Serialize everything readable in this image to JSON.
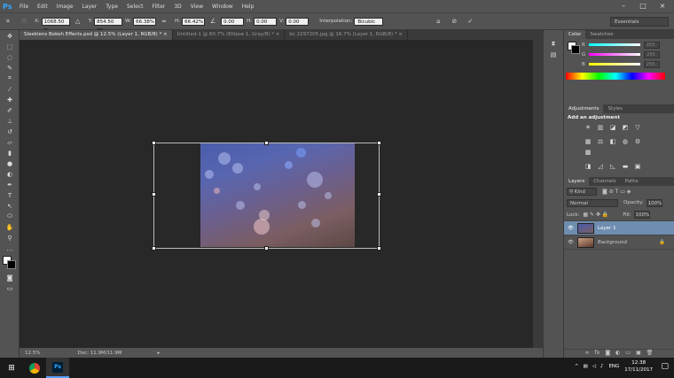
{
  "app": {
    "logo": "Ps"
  },
  "menu": [
    "File",
    "Edit",
    "Image",
    "Layer",
    "Type",
    "Select",
    "Filter",
    "3D",
    "View",
    "Window",
    "Help"
  ],
  "window_controls": [
    "–",
    "□",
    "×"
  ],
  "options": {
    "x_label": "X:",
    "x_value": "1068.50 p",
    "y_label": "Y:",
    "y_value": "854.50 px",
    "w_label": "W:",
    "w_value": "66.38%",
    "h_label": "H:",
    "h_value": "66.42%",
    "angle_value": "0.00",
    "hskew_label": "H:",
    "hskew_value": "0.00",
    "vskew_label": "V:",
    "vskew_value": "0.00",
    "interp_label": "Interpolation:",
    "interp_value": "Bicubic",
    "workspace": "Essentials"
  },
  "tabs": [
    "Sleeklens Bokeh Effects.psd @ 12.5% (Layer 1, RGB/8) * ×",
    "Untitled-1 @ 60.7% (Ellipse 1, Gray/8) * ×",
    "bc 2297205.jpg @ 16.7% (Layer 1, RGB/8) * ×"
  ],
  "status": {
    "zoom": "12.5%",
    "doc": "Doc: 11.9M/11.9M"
  },
  "color_panel": {
    "tabs": [
      "Color",
      "Swatches"
    ],
    "r_label": "R",
    "r_value": "255",
    "g_label": "G",
    "g_value": "255",
    "b_label": "B",
    "b_value": "255"
  },
  "adjustments_panel": {
    "tabs": [
      "Adjustments",
      "Styles"
    ],
    "heading": "Add an adjustment"
  },
  "layers_panel": {
    "tabs": [
      "Layers",
      "Channels",
      "Paths"
    ],
    "kind_label": "Kind",
    "blend_mode": "Normal",
    "opacity_label": "Opacity:",
    "opacity_value": "100%",
    "lock_label": "Lock:",
    "fill_label": "Fill:",
    "fill_value": "100%",
    "layers": [
      "Layer 1",
      "Background"
    ]
  },
  "taskbar": {
    "lang": "ENG",
    "time": "12:38",
    "date": "17/11/2017"
  },
  "colors": {
    "selected_layer": "#6e8db0",
    "ui_gray": "#535353",
    "canvas_bg": "#282828"
  }
}
